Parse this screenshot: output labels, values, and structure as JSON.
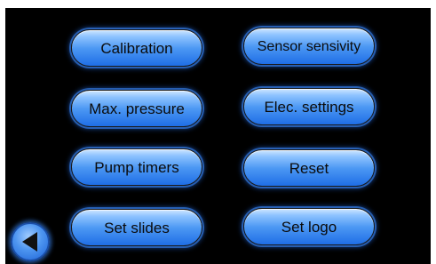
{
  "menu": {
    "buttons": [
      {
        "id": "calibration",
        "label": "Calibration"
      },
      {
        "id": "sensor-sensivity",
        "label": "Sensor sensivity"
      },
      {
        "id": "max-pressure",
        "label": "Max. pressure"
      },
      {
        "id": "elec-settings",
        "label": "Elec. settings"
      },
      {
        "id": "pump-timers",
        "label": "Pump timers"
      },
      {
        "id": "reset",
        "label": "Reset"
      },
      {
        "id": "set-slides",
        "label": "Set slides"
      },
      {
        "id": "set-logo",
        "label": "Set logo"
      }
    ]
  },
  "navigation": {
    "back_icon": "back-arrow-icon"
  },
  "colors": {
    "background": "#000000",
    "button_blue": "#4b97f3",
    "button_glow": "#3c8cff"
  }
}
